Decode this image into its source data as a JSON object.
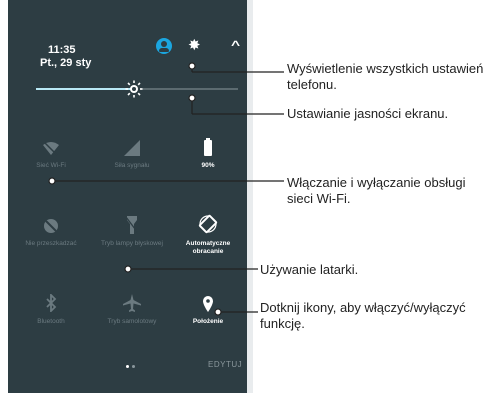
{
  "status": {
    "time": "11:35",
    "date": "Pt., 29 sty"
  },
  "icons": {
    "account": "account-icon",
    "settings": "gear-icon",
    "collapse": "chevron-up-icon"
  },
  "brightness": {
    "level": 0.45
  },
  "tiles": [
    {
      "label": "Sieć Wi-Fi",
      "icon": "wifi-icon",
      "active": false
    },
    {
      "label": "Siła sygnału",
      "icon": "signal-icon",
      "active": false
    },
    {
      "label": "90%",
      "icon": "battery-icon",
      "active": true
    },
    {
      "label": "Nie przeszkadzać",
      "icon": "do-not-disturb-icon",
      "active": false
    },
    {
      "label": "Tryb lampy błyskowej",
      "icon": "flashlight-icon",
      "active": false
    },
    {
      "label": "Automatyczne obracanie",
      "icon": "auto-rotate-icon",
      "active": true
    },
    {
      "label": "Bluetooth",
      "icon": "bluetooth-icon",
      "active": false
    },
    {
      "label": "Tryb samolotowy",
      "icon": "airplane-icon",
      "active": false
    },
    {
      "label": "Położenie",
      "icon": "location-icon",
      "active": true
    }
  ],
  "footer": {
    "edit": "EDYTUJ"
  },
  "callouts": [
    "Wyświetlenie wszystkich ustawień telefonu.",
    "Ustawianie jasności ekranu.",
    "Włączanie i wyłączanie obsługi sieci Wi-Fi.",
    "Używanie latarki.",
    "Dotknij ikony, aby włączyć/wyłączyć funkcję."
  ],
  "colors": {
    "panel": "#2d3d43",
    "accent": "#1ba6e0",
    "slider_on": "#b9e9f5",
    "inactive": "#6b7a80"
  }
}
